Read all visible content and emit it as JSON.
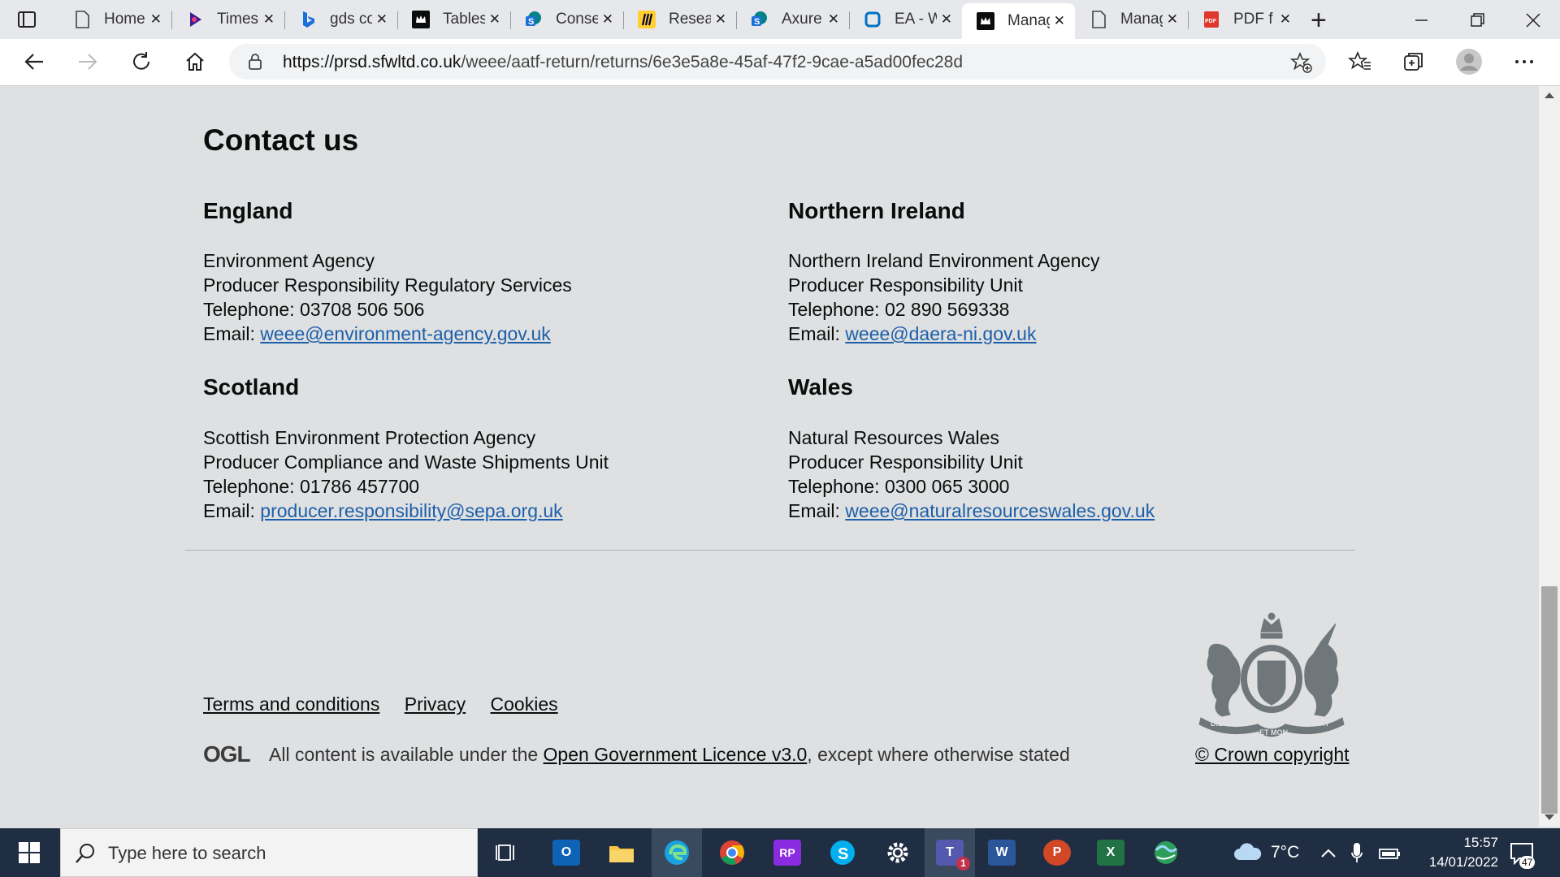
{
  "browser": {
    "tabs": [
      {
        "title": "Home",
        "favicon": "page-icon"
      },
      {
        "title": "Timesheet",
        "favicon": "pega-icon"
      },
      {
        "title": "gds conte",
        "favicon": "bing-icon"
      },
      {
        "title": "Tables",
        "favicon": "crown-icon"
      },
      {
        "title": "Consent",
        "favicon": "sharepoint-icon"
      },
      {
        "title": "Research",
        "favicon": "miro-icon"
      },
      {
        "title": "Axure",
        "favicon": "sharepoint-icon"
      },
      {
        "title": "EA - W",
        "favicon": "azure-icon"
      },
      {
        "title": "Manage",
        "favicon": "crown-icon",
        "active": true
      },
      {
        "title": "Manage",
        "favicon": "page-icon"
      },
      {
        "title": "PDF f",
        "favicon": "pdf-icon"
      }
    ],
    "new_tab_symbol": "+",
    "url_host": "https://prsd.sfwltd.co.uk",
    "url_path": "/weee/aatf-return/returns/6e3e5a8e-45af-47f2-9cae-a5ad00fec28d"
  },
  "page": {
    "heading": "Contact us",
    "contacts": {
      "england": {
        "region": "England",
        "org": "Environment Agency",
        "unit": "Producer Responsibility Regulatory Services",
        "telephone_label": "Telephone: ",
        "telephone": "03708 506 506",
        "email_label": "Email: ",
        "email": "weee@environment-agency.gov.uk"
      },
      "northern_ireland": {
        "region": "Northern Ireland",
        "org": "Northern Ireland Environment Agency",
        "unit": "Producer Responsibility Unit",
        "telephone_label": "Telephone: ",
        "telephone": "02 890 569338",
        "email_label": "Email: ",
        "email": "weee@daera-ni.gov.uk"
      },
      "scotland": {
        "region": "Scotland",
        "org": "Scottish Environment Protection Agency",
        "unit": "Producer Compliance and Waste Shipments Unit",
        "telephone_label": "Telephone: ",
        "telephone": "01786 457700",
        "email_label": "Email: ",
        "email": "producer.responsibility@sepa.org.uk"
      },
      "wales": {
        "region": "Wales",
        "org": "Natural Resources Wales",
        "unit": "Producer Responsibility Unit",
        "telephone_label": "Telephone: ",
        "telephone": "0300 065 3000",
        "email_label": "Email: ",
        "email": "weee@naturalresourceswales.gov.uk"
      }
    },
    "footer": {
      "links": [
        "Terms and conditions",
        "Privacy",
        "Cookies"
      ],
      "ogl_logo": "OGL",
      "licence_prefix": "All content is available under the ",
      "licence_link": "Open Government Licence v3.0",
      "licence_suffix": ", except where otherwise stated",
      "copyright": "© Crown copyright",
      "crest_motto": [
        "DIEU",
        "ET MON",
        "DROIT"
      ]
    }
  },
  "taskbar": {
    "search_placeholder": "Type here to search",
    "weather_temp": "7°C",
    "time": "15:57",
    "date": "14/01/2022",
    "notification_count": "47",
    "teams_badge": "1",
    "apps": [
      "task-view",
      "outlook",
      "file-explorer",
      "edge",
      "chrome",
      "rp",
      "skype",
      "settings",
      "teams",
      "word",
      "powerpoint",
      "excel",
      "globe"
    ]
  },
  "colors": {
    "page_background": "#dee0e2",
    "link": "#1d5fa8",
    "taskbar": "#1f2e43"
  }
}
